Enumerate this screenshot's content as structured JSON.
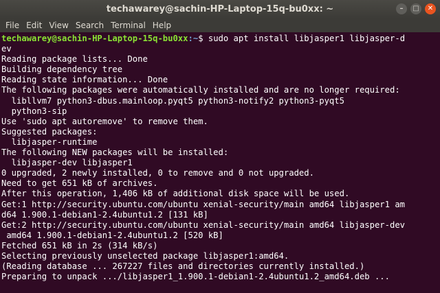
{
  "window": {
    "title": "techawarey@sachin-HP-Laptop-15q-bu0xx: ~",
    "controls": {
      "minimize": "–",
      "maximize": "□",
      "close": "✕"
    }
  },
  "menubar": {
    "items": [
      "File",
      "Edit",
      "View",
      "Search",
      "Terminal",
      "Help"
    ]
  },
  "terminal": {
    "prompt": {
      "user_host": "techawarey@sachin-HP-Laptop-15q-bu0xx",
      "path": ":~",
      "symbol": "$",
      "command": " sudo apt install libjasper1 libjasper-d"
    },
    "lines": [
      "ev",
      "Reading package lists... Done",
      "Building dependency tree",
      "Reading state information... Done",
      "The following packages were automatically installed and are no longer required:",
      "  libllvm7 python3-dbus.mainloop.pyqt5 python3-notify2 python3-pyqt5",
      "  python3-sip",
      "Use 'sudo apt autoremove' to remove them.",
      "Suggested packages:",
      "  libjasper-runtime",
      "The following NEW packages will be installed:",
      "  libjasper-dev libjasper1",
      "0 upgraded, 2 newly installed, 0 to remove and 0 not upgraded.",
      "Need to get 651 kB of archives.",
      "After this operation, 1,406 kB of additional disk space will be used.",
      "Get:1 http://security.ubuntu.com/ubuntu xenial-security/main amd64 libjasper1 am",
      "d64 1.900.1-debian1-2.4ubuntu1.2 [131 kB]",
      "Get:2 http://security.ubuntu.com/ubuntu xenial-security/main amd64 libjasper-dev",
      " amd64 1.900.1-debian1-2.4ubuntu1.2 [520 kB]",
      "Fetched 651 kB in 2s (314 kB/s)",
      "Selecting previously unselected package libjasper1:amd64.",
      "(Reading database ... 267227 files and directories currently installed.)",
      "Preparing to unpack .../libjasper1_1.900.1-debian1-2.4ubuntu1.2_amd64.deb ..."
    ]
  },
  "colors": {
    "background": "#300a24",
    "text": "#ffffff",
    "prompt_user": "#8ae234",
    "prompt_path": "#729fcf",
    "titlebar": "#3c3b37",
    "close_button": "#e95420"
  }
}
